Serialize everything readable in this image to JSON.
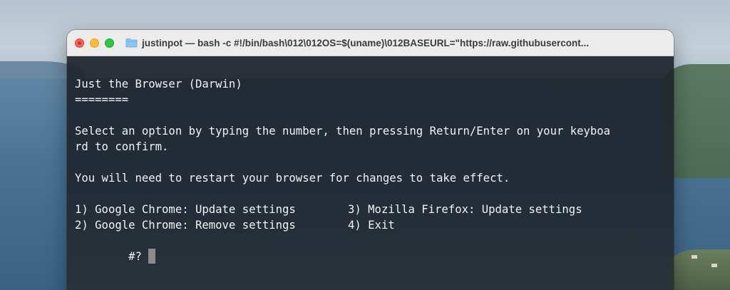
{
  "window": {
    "title": "justinpot — bash -c #!/bin/bash\\012\\012OS=$(uname)\\012BASEURL=\"https://raw.githubusercont...",
    "traffic_lights": [
      "close",
      "minimize",
      "maximize"
    ],
    "folder_icon": "folder-icon"
  },
  "terminal": {
    "heading": "Just the Browser (Darwin)",
    "underline": "========",
    "instructions_line1": "Select an option by typing the number, then pressing Return/Enter on your keyboa",
    "instructions_line2": "rd to confirm.",
    "restart_note": "You will need to restart your browser for changes to take effect.",
    "options": [
      {
        "label": "1) Google Chrome: Update settings"
      },
      {
        "label": "3) Mozilla Firefox: Update settings"
      },
      {
        "label": "2) Google Chrome: Remove settings"
      },
      {
        "label": "4) Exit"
      }
    ],
    "prompt": "#?"
  },
  "colors": {
    "terminal_text": "#f2f2f2",
    "close": "#fe5f57",
    "minimize": "#febc2e",
    "maximize": "#28c840"
  }
}
